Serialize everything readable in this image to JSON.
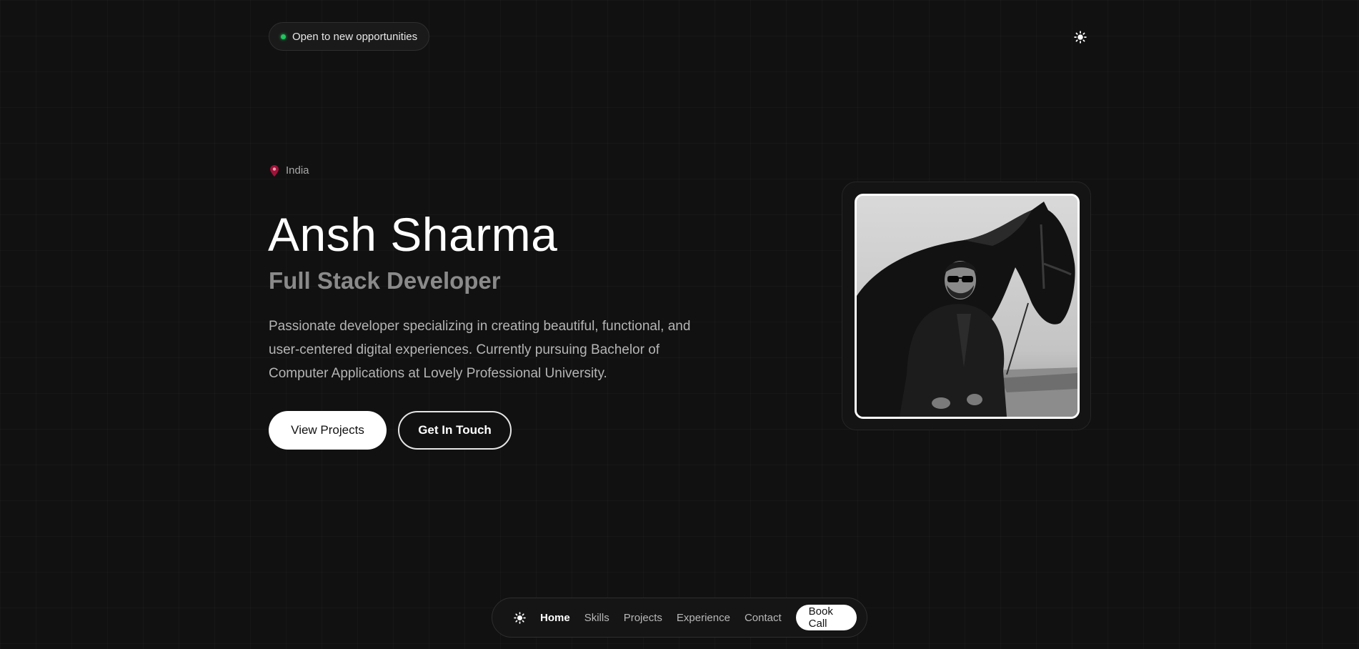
{
  "status": {
    "label": "Open to new opportunities",
    "dot_color": "#22c55e"
  },
  "header": {
    "theme_icon": "sun-icon"
  },
  "hero": {
    "location_icon": "map-pin-icon",
    "location": "India",
    "name": "Ansh Sharma",
    "role": "Full Stack Developer",
    "description": "Passionate developer specializing in creating beautiful, functional, and user-centered digital experiences. Currently pursuing Bachelor of Computer Applications at Lovely Professional University.",
    "primary_button": "View Projects",
    "secondary_button": "Get In Touch"
  },
  "portrait": {
    "subject": "profile-photo"
  },
  "nav": {
    "theme_icon": "sun-icon",
    "items": [
      {
        "label": "Home",
        "active": true
      },
      {
        "label": "Skills",
        "active": false
      },
      {
        "label": "Projects",
        "active": false
      },
      {
        "label": "Experience",
        "active": false
      },
      {
        "label": "Contact",
        "active": false
      }
    ],
    "cta": "Book Call"
  },
  "colors": {
    "background": "#111111",
    "accent": "#ffffff",
    "status_green": "#22c55e",
    "pin_red": "#e11d48"
  }
}
